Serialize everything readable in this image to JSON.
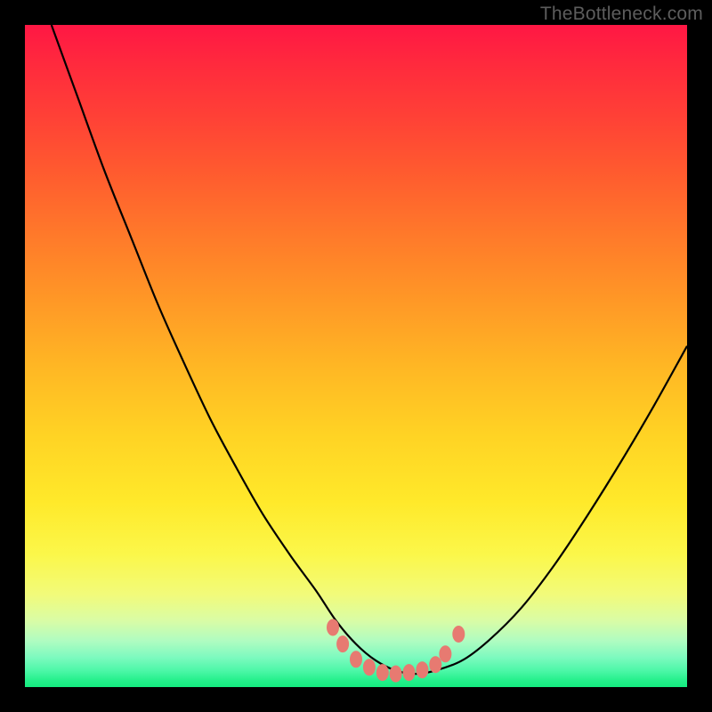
{
  "watermark": "TheBottleneck.com",
  "chart_data": {
    "type": "line",
    "title": "",
    "xlabel": "",
    "ylabel": "",
    "xlim": [
      0,
      100
    ],
    "ylim": [
      0,
      100
    ],
    "grid": false,
    "legend": false,
    "series": [
      {
        "name": "bottleneck-curve",
        "x": [
          4,
          8,
          12,
          16,
          20,
          24,
          28,
          32,
          36,
          40,
          44,
          47,
          50,
          53,
          56,
          59,
          62,
          66,
          70,
          75,
          80,
          85,
          90,
          95,
          100
        ],
        "y": [
          100,
          89,
          78,
          68,
          58,
          49,
          40.5,
          33,
          26,
          20,
          14.5,
          10,
          6.5,
          4,
          2.5,
          2,
          2.5,
          4,
          7,
          12,
          18.5,
          26,
          34,
          42.5,
          51.5
        ]
      }
    ],
    "markers": {
      "name": "flat-region-markers",
      "x": [
        46.5,
        48,
        50,
        52,
        54,
        56,
        58,
        60,
        62,
        63.5,
        65.5
      ],
      "y": [
        9,
        6.5,
        4.2,
        3,
        2.2,
        2,
        2.2,
        2.6,
        3.4,
        5,
        8
      ]
    },
    "background_gradient": {
      "stops": [
        {
          "pos": 0,
          "color": "#ff1744"
        },
        {
          "pos": 14,
          "color": "#ff4136"
        },
        {
          "pos": 32,
          "color": "#ff7a2a"
        },
        {
          "pos": 52,
          "color": "#ffb824"
        },
        {
          "pos": 72,
          "color": "#ffe92a"
        },
        {
          "pos": 86,
          "color": "#f2fb7a"
        },
        {
          "pos": 95,
          "color": "#7dfabf"
        },
        {
          "pos": 100,
          "color": "#14ec7f"
        }
      ]
    }
  }
}
